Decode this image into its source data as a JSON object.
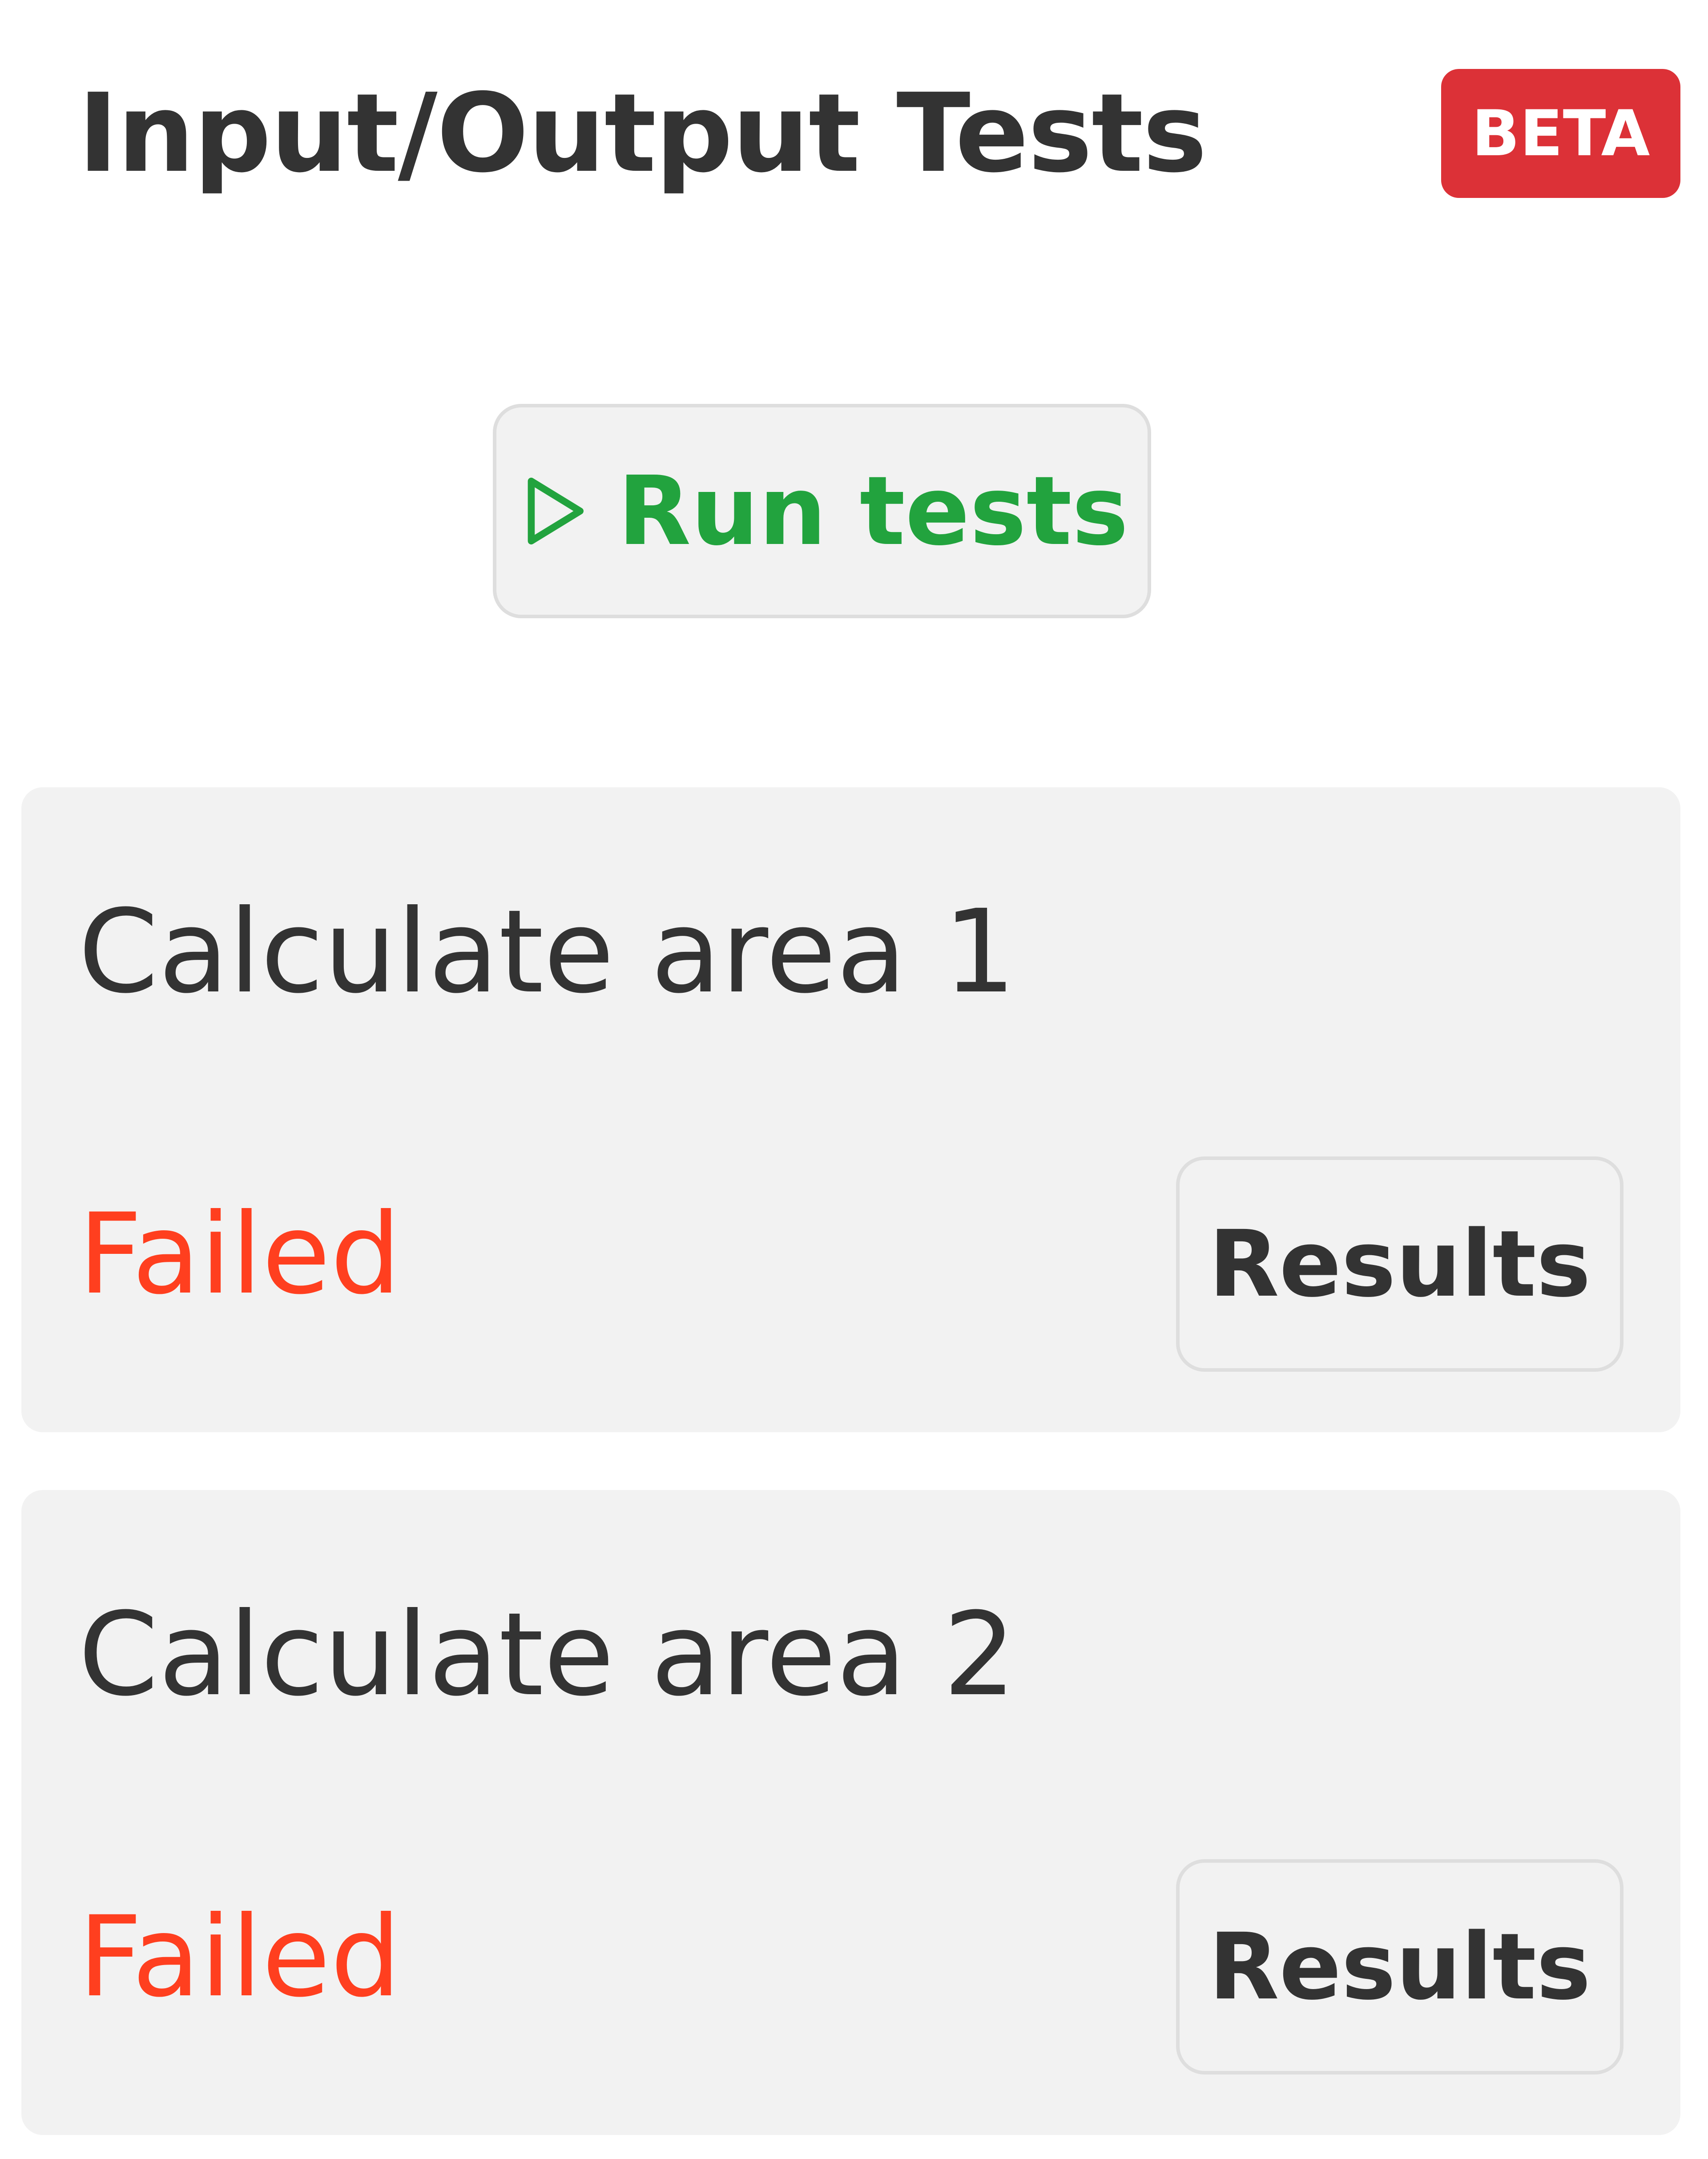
{
  "header": {
    "title": "Input/Output Tests",
    "badge": "BETA",
    "badge_color": "#dc3137"
  },
  "run_button": {
    "label": "Run tests",
    "icon": "play-icon",
    "color": "#22a33e"
  },
  "tests": [
    {
      "name": "Calculate area 1",
      "status": "Failed",
      "results_label": "Results"
    },
    {
      "name": "Calculate area 2",
      "status": "Failed",
      "results_label": "Results"
    }
  ],
  "colors": {
    "failed": "#ff3f1f",
    "card_background": "#f2f2f2",
    "text": "#333333"
  }
}
